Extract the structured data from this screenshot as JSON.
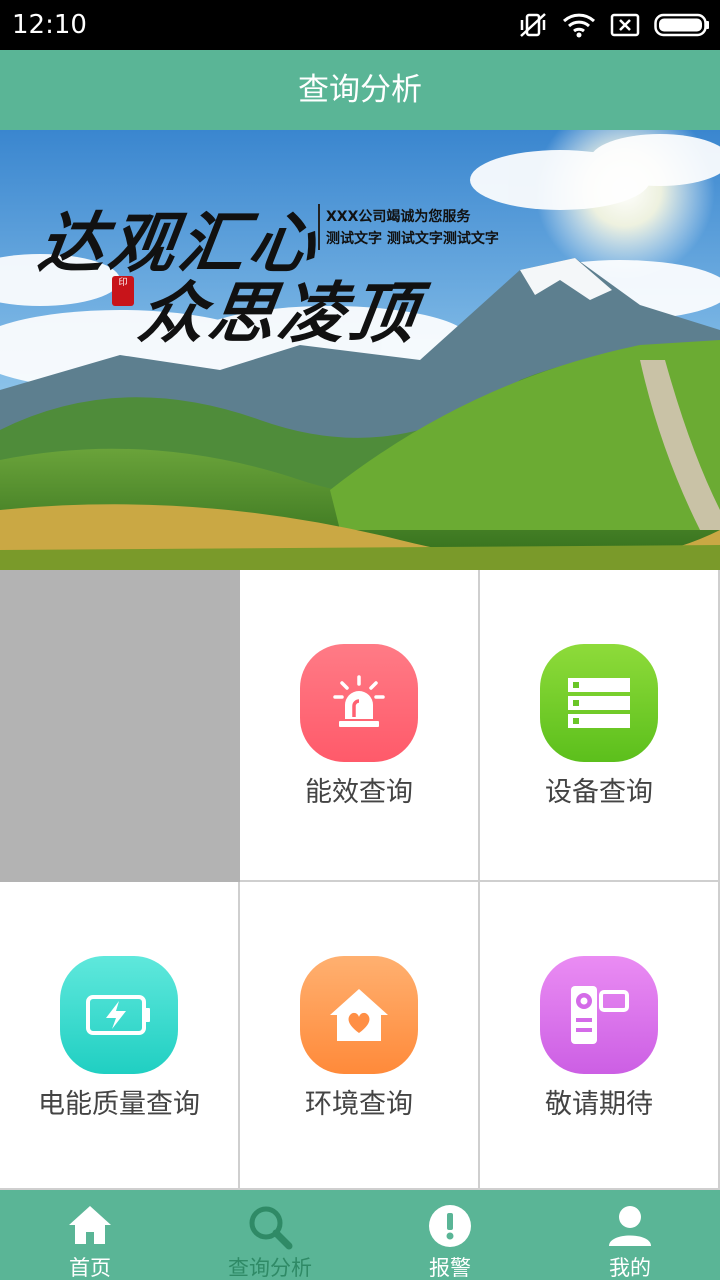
{
  "status_bar": {
    "time": "12:10"
  },
  "header": {
    "title": "查询分析"
  },
  "banner": {
    "calligraphy_line1": "达观汇心",
    "calligraphy_line2": "众思凌顶",
    "seal": "印",
    "slogan_line1": "XXX公司竭诚为您服务",
    "slogan_line2": "测试文字 测试文字测试文字"
  },
  "tiles": [
    {
      "label": "能效查询",
      "icon": "alarm-light-icon",
      "colors": [
        "#ff7b86",
        "#ff5a6a"
      ]
    },
    {
      "label": "设备查询",
      "icon": "server-icon",
      "colors": [
        "#8edb3a",
        "#5cbf1c"
      ]
    },
    {
      "label": "电能质量查询",
      "icon": "battery-charge-icon",
      "colors": [
        "#5fe8dc",
        "#20cfc2"
      ]
    },
    {
      "label": "环境查询",
      "icon": "home-heart-icon",
      "colors": [
        "#ffb070",
        "#ff8a3a"
      ]
    },
    {
      "label": "敬请期待",
      "icon": "camcorder-icon",
      "colors": [
        "#ea8cf3",
        "#cc5fe4"
      ]
    }
  ],
  "bottom_nav": [
    {
      "label": "首页",
      "icon": "home-icon",
      "active": true
    },
    {
      "label": "查询分析",
      "icon": "search-icon",
      "active": false
    },
    {
      "label": "报警",
      "icon": "alert-icon",
      "active": true
    },
    {
      "label": "我的",
      "icon": "user-icon",
      "active": true
    }
  ],
  "colors": {
    "primary": "#5ab596",
    "tile_border": "#cfcfcf",
    "placeholder_gray": "#b3b3b3"
  }
}
